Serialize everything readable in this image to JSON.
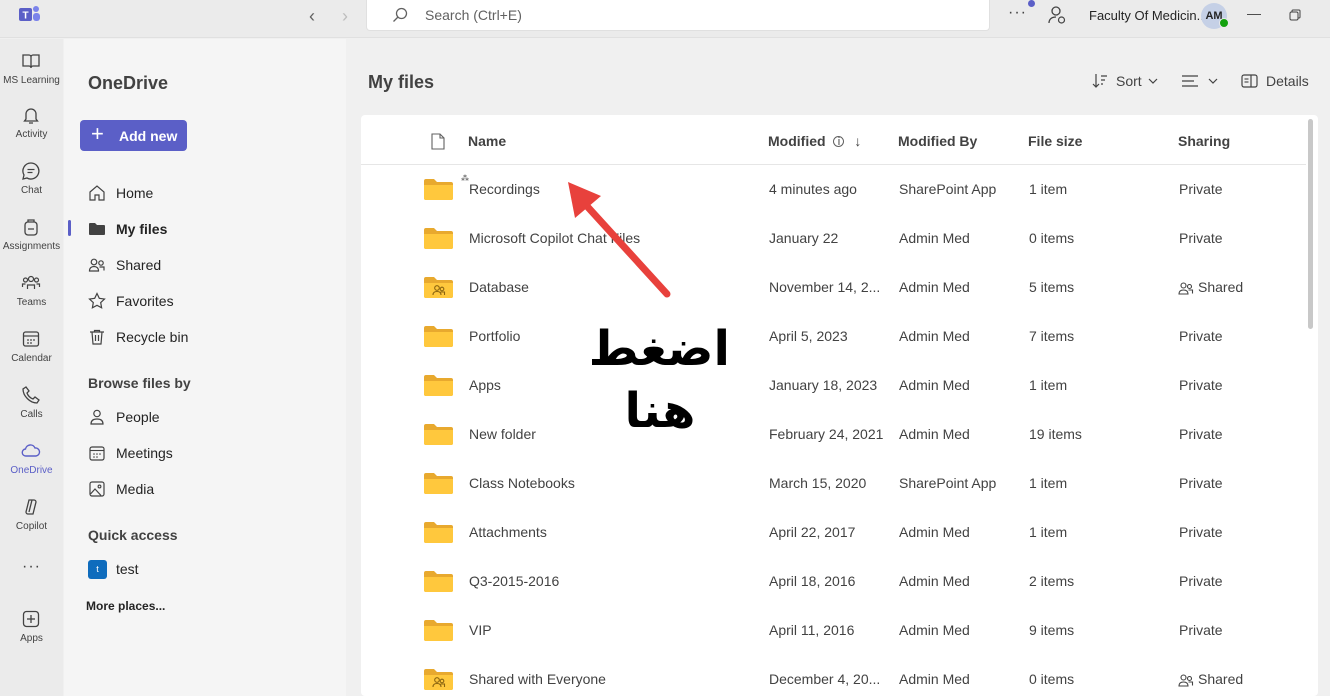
{
  "titlebar": {
    "search_placeholder": "Search (Ctrl+E)",
    "org_name": "Faculty Of Medicin...",
    "avatar_initials": "AM"
  },
  "rail": {
    "items": [
      {
        "label": "MS Learning",
        "icon": "book-icon"
      },
      {
        "label": "Activity",
        "icon": "bell-icon"
      },
      {
        "label": "Chat",
        "icon": "chat-icon"
      },
      {
        "label": "Assignments",
        "icon": "backpack-icon"
      },
      {
        "label": "Teams",
        "icon": "people-icon"
      },
      {
        "label": "Calendar",
        "icon": "calendar-icon"
      },
      {
        "label": "Calls",
        "icon": "phone-icon"
      },
      {
        "label": "OneDrive",
        "icon": "cloud-icon",
        "active": true
      },
      {
        "label": "Copilot",
        "icon": "copilot-icon"
      },
      {
        "label": "Apps",
        "icon": "add-app-icon"
      }
    ]
  },
  "leftpane": {
    "title": "OneDrive",
    "add_new": "Add new",
    "nav": [
      {
        "label": "Home",
        "icon": "home-icon"
      },
      {
        "label": "My files",
        "icon": "folder-icon",
        "active": true
      },
      {
        "label": "Shared",
        "icon": "shared-icon"
      },
      {
        "label": "Favorites",
        "icon": "star-icon"
      },
      {
        "label": "Recycle bin",
        "icon": "trash-icon"
      }
    ],
    "browse_by_heading": "Browse files by",
    "browse": [
      {
        "label": "People",
        "icon": "person-icon"
      },
      {
        "label": "Meetings",
        "icon": "calendar-icon"
      },
      {
        "label": "Media",
        "icon": "image-icon"
      }
    ],
    "quick_access_heading": "Quick access",
    "quick_access": [
      {
        "label": "test",
        "badge": "t"
      }
    ],
    "more_places": "More places..."
  },
  "main": {
    "title": "My files",
    "sort_label": "Sort",
    "details_label": "Details",
    "columns": {
      "name": "Name",
      "modified": "Modified",
      "modified_by": "Modified By",
      "file_size": "File size",
      "sharing": "Sharing"
    },
    "rows": [
      {
        "name": "Recordings",
        "modified": "4 minutes ago",
        "modified_by": "SharePoint App",
        "size": "1 item",
        "sharing": "Private",
        "shared_folder": false
      },
      {
        "name": "Microsoft Copilot Chat Files",
        "modified": "January 22",
        "modified_by": "Admin Med",
        "size": "0 items",
        "sharing": "Private",
        "shared_folder": false
      },
      {
        "name": "Database",
        "modified": "November 14, 2...",
        "modified_by": "Admin Med",
        "size": "5 items",
        "sharing": "Shared",
        "shared_folder": true
      },
      {
        "name": "Portfolio",
        "modified": "April 5, 2023",
        "modified_by": "Admin Med",
        "size": "7 items",
        "sharing": "Private",
        "shared_folder": false
      },
      {
        "name": "Apps",
        "modified": "January 18, 2023",
        "modified_by": "Admin Med",
        "size": "1 item",
        "sharing": "Private",
        "shared_folder": false
      },
      {
        "name": "New folder",
        "modified": "February 24, 2021",
        "modified_by": "Admin Med",
        "size": "19 items",
        "sharing": "Private",
        "shared_folder": false
      },
      {
        "name": "Class Notebooks",
        "modified": "March 15, 2020",
        "modified_by": "SharePoint App",
        "size": "1 item",
        "sharing": "Private",
        "shared_folder": false
      },
      {
        "name": "Attachments",
        "modified": "April 22, 2017",
        "modified_by": "Admin Med",
        "size": "1 item",
        "sharing": "Private",
        "shared_folder": false
      },
      {
        "name": "Q3-2015-2016",
        "modified": "April 18, 2016",
        "modified_by": "Admin Med",
        "size": "2 items",
        "sharing": "Private",
        "shared_folder": false
      },
      {
        "name": "VIP",
        "modified": "April 11, 2016",
        "modified_by": "Admin Med",
        "size": "9 items",
        "sharing": "Private",
        "shared_folder": false
      },
      {
        "name": "Shared with Everyone",
        "modified": "December 4, 20...",
        "modified_by": "Admin Med",
        "size": "0 items",
        "sharing": "Shared",
        "shared_folder": true
      }
    ]
  },
  "annotation": {
    "line1": "اضغط",
    "line2": "هنا",
    "color": "#e8413c"
  }
}
